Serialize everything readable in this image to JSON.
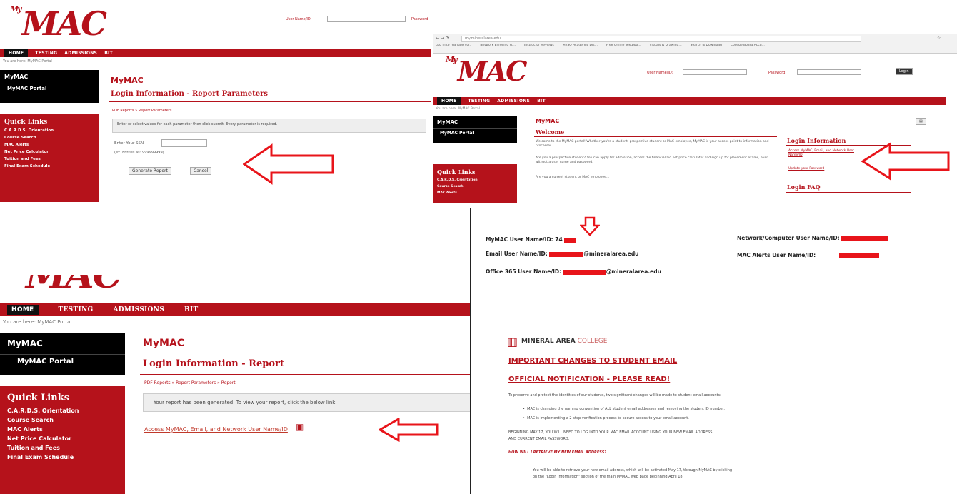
{
  "panel1": {
    "logo_prefix": "My",
    "logo": "MAC",
    "user_label": "User Name/ID:",
    "password_label": "Password",
    "nav": [
      "HOME",
      "TESTING",
      "ADMISSIONS",
      "BIT"
    ],
    "crumb": "You are here: MyMAC Portal",
    "side_title": "MyMAC",
    "side_item": "MyMAC Portal",
    "quick_links_title": "Quick Links",
    "quick_links": [
      "C.A.R.D.S. Orientation",
      "Course Search",
      "MAC Alerts",
      "Net Price Calculator",
      "Tuition and Fees",
      "Final Exam Schedule"
    ],
    "heading": "MyMAC",
    "subheading": "Login Information - Report Parameters",
    "crumb2": "PDF Reports » Report Parameters",
    "info": "Enter or select values for each parameter then click submit. Every parameter is required.",
    "ssn_label": "Enter Your SSN",
    "ssn_hint": "(ex. Entries as: 999999999)",
    "generate_btn": "Generate Report",
    "cancel_btn": "Cancel"
  },
  "panel2": {
    "url": "my.mineralarea.edu",
    "bookmarks": [
      "Log in to manage yo...",
      "Network Enrolling st...",
      "Instructor Reviews",
      "MySQ Academic Dis...",
      "Free Online Textboo...",
      "Visuals & Drawing...",
      "Search & Download",
      "College Board Accu..."
    ],
    "logo_prefix": "My",
    "logo": "MAC",
    "user_label": "User Name/ID:",
    "password_label": "Password:",
    "login_btn": "Login",
    "nav": [
      "HOME",
      "TESTING",
      "ADMISSIONS",
      "BIT"
    ],
    "crumb": "You are here: MyMAC Portal",
    "side_title": "MyMAC",
    "side_item": "MyMAC Portal",
    "quick_links_title": "Quick Links",
    "quick_links": [
      "C.A.R.D.S. Orientation",
      "Course Search",
      "MAC Alerts"
    ],
    "heading": "MyMAC",
    "welcome": "Welcome",
    "p1": "Welcome to the MyMAC portal! Whether you're a student, prospective student or MAC employee, MyMAC is your access point to information and processes.",
    "p2": "Are you a prospective student? You can apply for admission, access the financial aid net price calculator and sign up for placement exams, even without a user name and password.",
    "p3": "Are you a current student or MAC employee...",
    "login_info_title": "Login Information",
    "login_link1": "Access MyMAC, Email, and Network User Name/ID",
    "login_link2": "Update your Password",
    "login_faq": "Login FAQ"
  },
  "panel3": {
    "logo": "MAC",
    "nav": [
      "HOME",
      "TESTING",
      "ADMISSIONS",
      "BIT"
    ],
    "crumb": "You are here: MyMAC Portal",
    "side_title": "MyMAC",
    "side_item": "MyMAC Portal",
    "quick_links_title": "Quick Links",
    "quick_links": [
      "C.A.R.D.S. Orientation",
      "Course Search",
      "MAC Alerts",
      "Net Price Calculator",
      "Tuition and Fees",
      "Final Exam Schedule"
    ],
    "heading": "MyMAC",
    "subheading": "Login Information - Report",
    "crumb2": "PDF Reports » Report Parameters » Report",
    "info": "Your report has been generated. To view your report, click the below link.",
    "report_link": "Access MyMAC, Email, and Network User Name/ID"
  },
  "panel4": {
    "mymac_label": "MyMAC User Name/ID: 74",
    "email_label": "Email User Name/ID:",
    "email_suffix": "@mineralarea.edu",
    "o365_label": "Office 365 User Name/ID:",
    "o365_suffix": "@mineralarea.edu",
    "network_label": "Network/Computer User Name/ID:",
    "alerts_label": "MAC Alerts User Name/ID:",
    "college_bold": "MINERAL AREA",
    "college_light": "COLLEGE",
    "h1": "IMPORTANT CHANGES TO STUDENT EMAIL",
    "h2": "OFFICIAL NOTIFICATION - PLEASE READ!",
    "intro": "To preserve and protect the identities of our students, two significant changes will be made to student email accounts:",
    "bullets": [
      "MAC is changing the naming convention of ALL student email addresses and removing the student ID number.",
      "MAC is implementing a 2-step verification process to secure access to your email account."
    ],
    "beginning_1": "BEGINNING MAY 17, YOU WILL NEED TO LOG INTO YOUR MAC EMAIL ACCOUNT USING YOUR NEW EMAIL ADDRESS",
    "beginning_2": "AND CURRENT EMAIL PASSWORD.",
    "question": "HOW WILL I RETRIEVE MY NEW EMAIL ADDRESS?",
    "answer_1": "You will be able to retrieve your new email address, which will be activated May 17, through MyMAC by clicking",
    "answer_2": "on the \"Login Information\" section of the main MyMAC web page beginning April 18."
  }
}
